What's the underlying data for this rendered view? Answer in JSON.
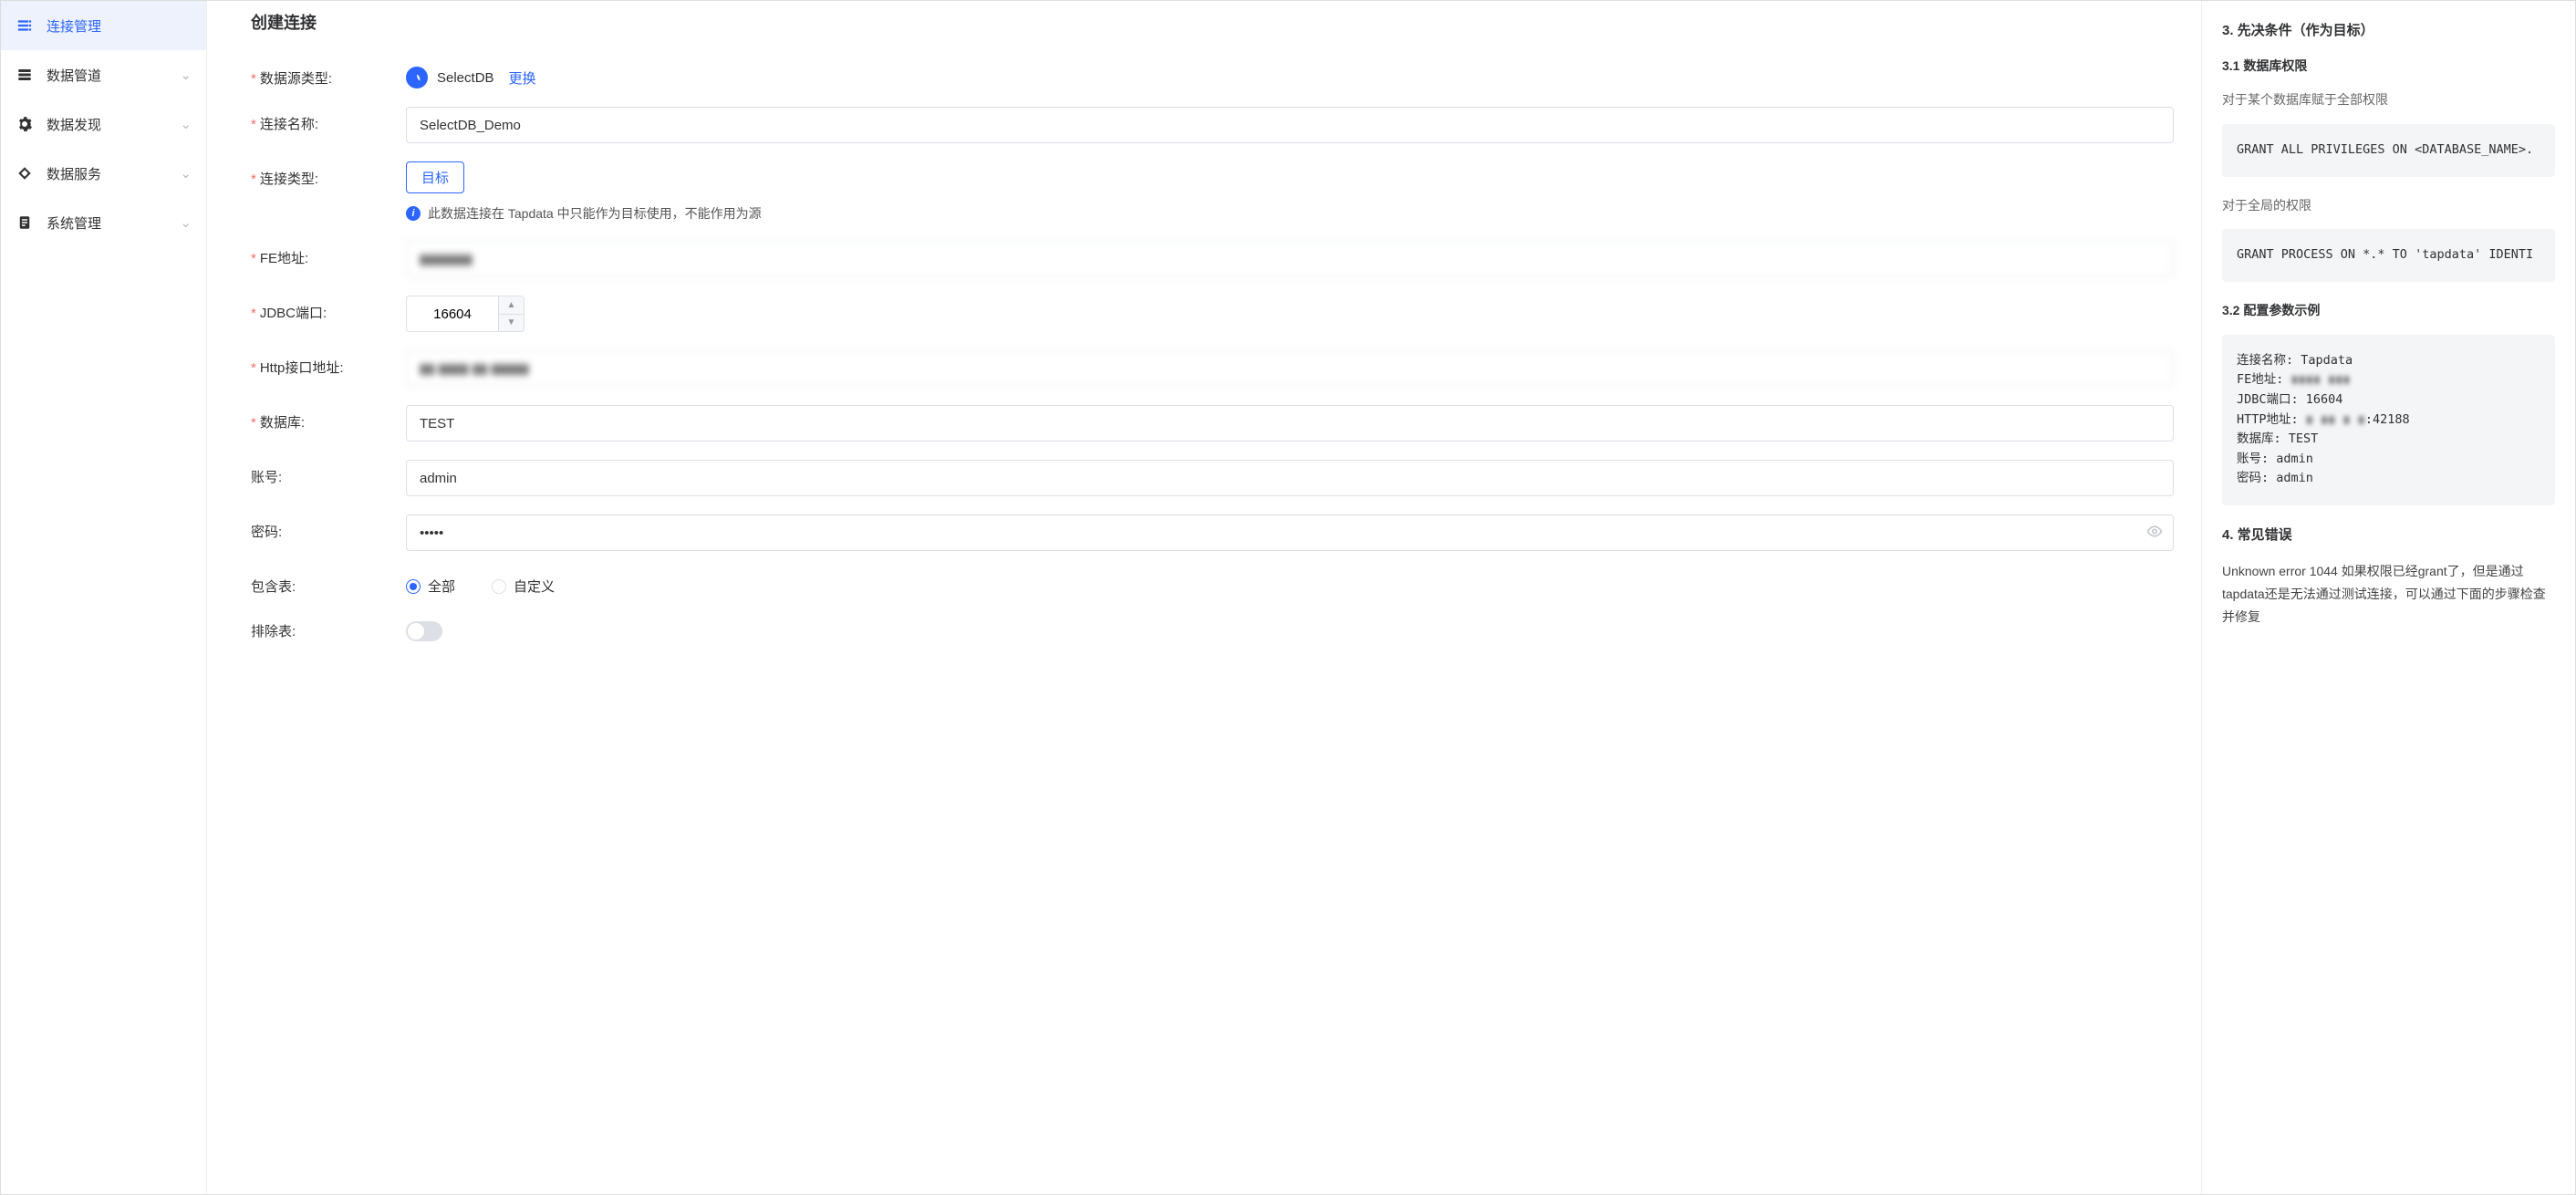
{
  "sidebar": {
    "items": [
      {
        "label": "连接管理",
        "active": true
      },
      {
        "label": "数据管道"
      },
      {
        "label": "数据发现"
      },
      {
        "label": "数据服务"
      },
      {
        "label": "系统管理"
      }
    ]
  },
  "main": {
    "title": "创建连接",
    "labels": {
      "dsType": "数据源类型:",
      "connName": "连接名称:",
      "connType": "连接类型:",
      "feAddr": "FE地址:",
      "jdbcPort": "JDBC端口:",
      "httpAddr": "Http接口地址:",
      "database": "数据库:",
      "account": "账号:",
      "password": "密码:",
      "includeTables": "包含表:",
      "excludeTables": "排除表:"
    },
    "dsName": "SelectDB",
    "changeLabel": "更换",
    "connTypeValue": "目标",
    "connTypeHint": "此数据连接在 Tapdata 中只能作为目标使用，不能作用为源",
    "values": {
      "connName": "SelectDB_Demo",
      "feAddr": "▮▮▮▮▮▮▮",
      "jdbcPort": "16604",
      "httpAddr": "▮▮ ▮▮▮▮ ▮▮ ▮▮▮▮▮",
      "database": "TEST",
      "account": "admin",
      "password": "•••••"
    },
    "radio": {
      "all": "全部",
      "custom": "自定义"
    }
  },
  "right": {
    "section3Title": "3. 先决条件（作为目标）",
    "section31Title": "3.1 数据库权限",
    "desc1": "对于某个数据库赋于全部权限",
    "code1": "GRANT ALL PRIVILEGES ON <DATABASE_NAME>.",
    "desc2": "对于全局的权限",
    "code2": "GRANT PROCESS ON *.* TO 'tapdata' IDENTI",
    "section32Title": "3.2 配置参数示例",
    "exampleLines": {
      "l1": "连接名称: Tapdata",
      "l2a": "FE地址: ",
      "l2b": "▮▮▮▮ ▮▮▮",
      "l3": "JDBC端口: 16604",
      "l4a": "HTTP地址: ",
      "l4b": "▮ ▮▮ ▮ ▮",
      "l4c": ":42188",
      "l5": "数据库: TEST",
      "l6": "账号: admin",
      "l7": "密码: admin"
    },
    "section4Title": "4. 常见错误",
    "errText": "Unknown error 1044 如果权限已经grant了，但是通过tapdata还是无法通过测试连接，可以通过下面的步骤检查并修复"
  }
}
